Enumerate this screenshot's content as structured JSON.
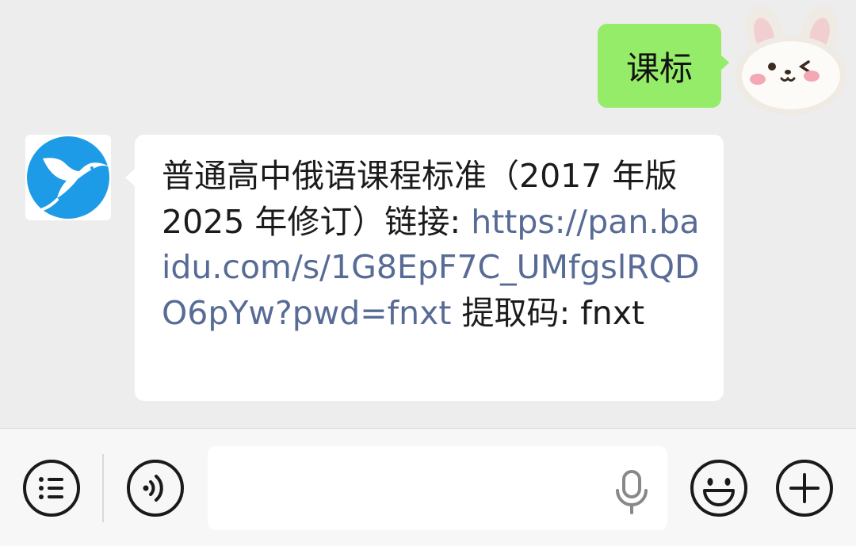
{
  "chat": {
    "outgoing_message": {
      "text": "课标"
    },
    "incoming_message": {
      "text_before_link": "普通高中俄语课程标准（2017 年版 2025 年修订）链接: ",
      "link": "https://pan.baidu.com/s/1G8EpF7C_UMfgslRQDO6pYw?pwd=fnxt",
      "text_after_link": " 提取码: fnxt"
    }
  },
  "input_bar": {
    "input_value": "",
    "icons": [
      "menu-list-icon",
      "voice-icon",
      "microphone-icon",
      "emoji-icon",
      "plus-icon"
    ]
  },
  "colors": {
    "chat_background": "#ededed",
    "outgoing_bubble": "#95ec69",
    "incoming_bubble": "#ffffff",
    "link": "#576b95",
    "avatar_blue": "#1e9be6"
  }
}
